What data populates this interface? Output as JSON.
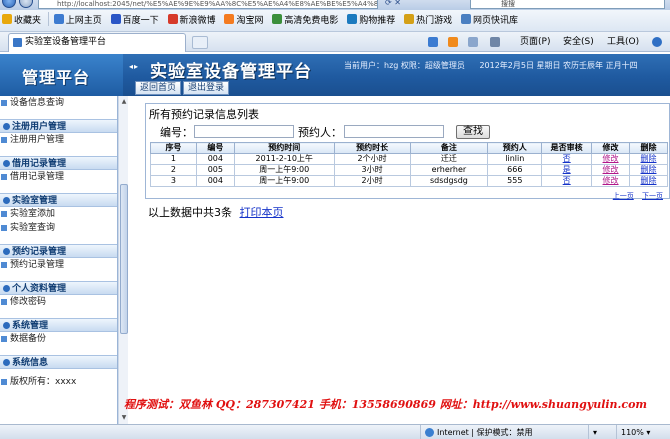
{
  "browser": {
    "url": "http://localhost:2045/net/%E5%AE%9E%E9%AA%8C%E5%AE%A4%E8%AE%BE%E5%A4%87%E7%AE%A1%E7%90%86...",
    "search_placeholder": "搜搜",
    "favorites_label": "收藏夹",
    "favorites": [
      {
        "label": "上网主页",
        "color": "#3d7bd0"
      },
      {
        "label": "百度一下",
        "color": "#2a56c6"
      },
      {
        "label": "新浪微博",
        "color": "#d63a2a"
      },
      {
        "label": "淘宝网",
        "color": "#f47b20"
      },
      {
        "label": "高清免费电影",
        "color": "#3b8f3b"
      },
      {
        "label": "购物推荐",
        "color": "#1c7bbf"
      },
      {
        "label": "热门游戏",
        "color": "#d4a017"
      },
      {
        "label": "网页快讯库",
        "color": "#4a7fc1"
      }
    ],
    "tab_title": "实验室设备管理平台",
    "commands": {
      "page": "页面(P)",
      "safety": "安全(S)",
      "tools": "工具(O)"
    }
  },
  "header": {
    "brand": "管理平台",
    "title": "实验室设备管理平台",
    "user_info": "当前用户：hzg  权限：超级管理员",
    "date_info": "2012年2月5日  星期日  农历壬辰年  正月十四",
    "buttons": {
      "home": "返回首页",
      "logout": "退出登录"
    }
  },
  "sidebar": {
    "top_item": "设备信息查询",
    "groups": [
      {
        "title": "注册用户管理",
        "items": [
          "注册用户管理"
        ]
      },
      {
        "title": "借用记录管理",
        "items": [
          "借用记录管理"
        ]
      },
      {
        "title": "实验室管理",
        "items": [
          "实验室添加",
          "实验室查询"
        ]
      },
      {
        "title": "预约记录管理",
        "items": [
          "预约记录管理"
        ]
      },
      {
        "title": "个人资料管理",
        "items": [
          "修改密码"
        ]
      },
      {
        "title": "系统管理",
        "items": [
          "数据备份"
        ]
      },
      {
        "title": "系统信息",
        "items": [
          "版权所有：xxxx"
        ]
      }
    ]
  },
  "main": {
    "panel_title": "所有预约记录信息列表",
    "search": {
      "field1_label": "编号：",
      "field2_label": "预约人：",
      "button": "查找"
    },
    "columns": [
      "序号",
      "编号",
      "预约时间",
      "预约时长",
      "备注",
      "预约人",
      "是否审核",
      "修改",
      "删除"
    ],
    "rows": [
      [
        "1",
        "004",
        "2011-2-10上午",
        "2个小时",
        "迁迁",
        "linlin",
        "否",
        "修改",
        "删除"
      ],
      [
        "2",
        "005",
        "周一上午9:00",
        "3小时",
        "erherher",
        "666",
        "是",
        "修改",
        "删除"
      ],
      [
        "3",
        "004",
        "周一上午9:00",
        "2小时",
        "sdsdgsdg",
        "555",
        "否",
        "修改",
        "删除"
      ]
    ],
    "pager": {
      "prev": "上一页",
      "next": "下一页"
    },
    "footer_text": "以上数据中共3条",
    "print_link": "打印本页"
  },
  "credit": "程序测试：双鱼林    QQ：287307421    手机：13558690869    网址：http://www.shuangyulin.com",
  "status": {
    "zone": "Internet | 保护模式：禁用",
    "zoom": "110%"
  }
}
